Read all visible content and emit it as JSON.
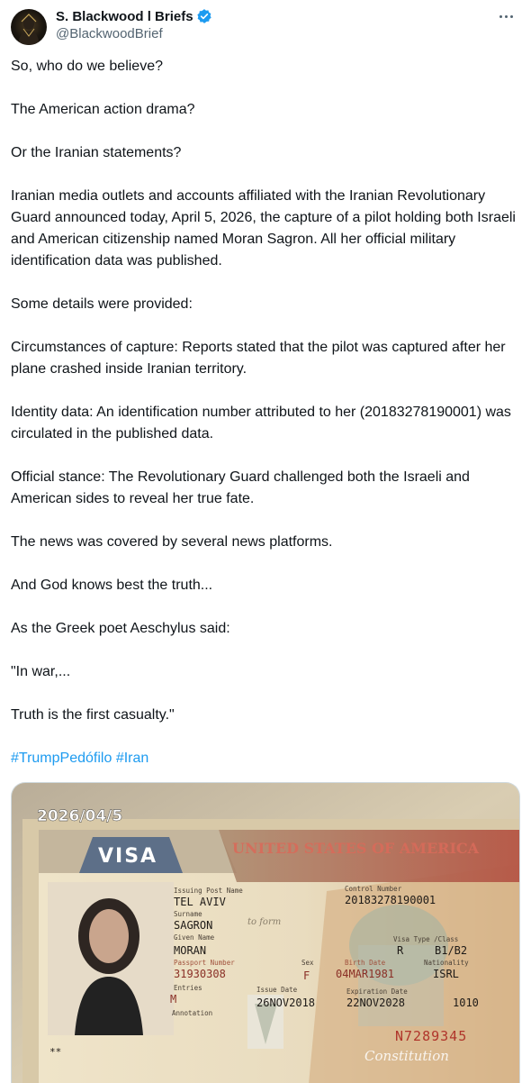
{
  "tweet": {
    "author": {
      "display_name": "S. Blackwood l Briefs",
      "handle": "@BlackwoodBrief",
      "verified": true,
      "avatar_icon": "avatar-icon"
    },
    "more_icon": "more-horizontal-icon",
    "paragraphs": [
      "So, who do we believe?",
      "The American action drama?",
      "Or the Iranian statements?",
      "Iranian media outlets and accounts affiliated with the Iranian Revolutionary Guard announced today, April 5, 2026, the capture of a pilot holding both Israeli and American citizenship named Moran Sagron. All her official military identification data was published.",
      "Some details were provided:",
      "Circumstances of capture: Reports stated that the pilot was captured after her plane crashed inside Iranian territory.",
      "Identity data: An identification number attributed to her (20183278190001) was circulated in the published data.",
      "Official stance: The Revolutionary Guard challenged both the Israeli and American sides to reveal her true fate.",
      "The news was covered by several news platforms.",
      "And God knows best the truth...",
      "As the Greek poet Aeschylus said:",
      "\"In war,...",
      "Truth is the first casualty.\""
    ],
    "hashtags": [
      "#TrumpPedófilo",
      "#Iran"
    ],
    "media": {
      "date_stamp": "2026/04/5",
      "visa_label": "VISA",
      "banner": "UNITED STATES OF AMERICA",
      "fields": {
        "issuing_post_label": "Issuing Post Name",
        "issuing_post": "TEL AVIV",
        "control_label": "Control Number",
        "control": "20183278190001",
        "surname_label": "Surname",
        "surname": "SAGRON",
        "given_label": "Given Name",
        "given": "MORAN",
        "visa_type_label": "Visa Type /Class",
        "visa_type": "R",
        "visa_class": "B1/B2",
        "passport_label": "Passport Number",
        "passport": "31930308",
        "sex_label": "Sex",
        "sex": "F",
        "birth_label": "Birth Date",
        "birth": "04MAR1981",
        "nationality_label": "Nationality",
        "nationality": "ISRL",
        "entries_label": "Entries",
        "entries": "M",
        "issue_label": "Issue Date",
        "issue": "26NOV2018",
        "expiry_label": "Expiration Date",
        "expiry": "22NOV2028",
        "annotation_label": "Annotation",
        "code": "1010",
        "serial": "N7289345",
        "stars": "**",
        "script_text": "to form",
        "bottom_script": "Constitution"
      }
    }
  }
}
